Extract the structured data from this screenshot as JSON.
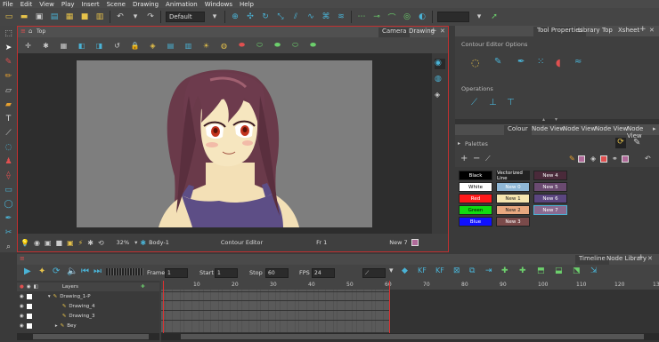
{
  "menu": [
    "File",
    "Edit",
    "View",
    "Play",
    "Insert",
    "Scene",
    "Drawing",
    "Animation",
    "Windows",
    "Help"
  ],
  "toolbar": {
    "workspace": "Default"
  },
  "camera_view": {
    "header": "Top",
    "tabs": [
      "Camera",
      "Drawing"
    ],
    "status": {
      "zoom": "32%",
      "node": "Body-1",
      "mode": "Contour Editor",
      "frame": "Fr 1",
      "colour": "New 7"
    }
  },
  "tool_panel": {
    "tabs": [
      "Tool Properties",
      "Library",
      "Top",
      "Xsheet"
    ],
    "title": "Contour Editor Options",
    "operations": "Operations"
  },
  "colour_panel": {
    "tabs": [
      "Colour",
      "Node View",
      "Node View",
      "Node View",
      "Node View"
    ],
    "palettes_label": "Palettes",
    "swatches": [
      {
        "label": "Black",
        "bg": "#000000",
        "fg": "#ffffff"
      },
      {
        "label": "Vectorized Line",
        "bg": "#222222",
        "fg": "#ffffff"
      },
      {
        "label": "New 4",
        "bg": "#4a2a3a",
        "fg": "#ffffff"
      },
      {
        "label": "White",
        "bg": "#ffffff",
        "fg": "#000000"
      },
      {
        "label": "New 0",
        "bg": "#8fb7d6",
        "fg": "#ffffff"
      },
      {
        "label": "New 5",
        "bg": "#6a4a70",
        "fg": "#ffffff"
      },
      {
        "label": "Red",
        "bg": "#ff1a1a",
        "fg": "#ffffff"
      },
      {
        "label": "New 1",
        "bg": "#f6e6b0",
        "fg": "#222222"
      },
      {
        "label": "New 6",
        "bg": "#5b4680",
        "fg": "#ffffff"
      },
      {
        "label": "Green",
        "bg": "#11dd11",
        "fg": "#000000"
      },
      {
        "label": "New 2",
        "bg": "#e8a880",
        "fg": "#222222"
      },
      {
        "label": "New 7",
        "bg": "#8a6a90",
        "fg": "#ffffff"
      },
      {
        "label": "Blue",
        "bg": "#1010ff",
        "fg": "#ffffff"
      },
      {
        "label": "New 3",
        "bg": "#7a4a4a",
        "fg": "#ffffff"
      }
    ]
  },
  "timeline": {
    "tabs": [
      "Timeline",
      "Node Library"
    ],
    "frame_label": "Frame",
    "frame": "1",
    "start_label": "Start",
    "start": "1",
    "stop_label": "Stop",
    "stop": "60",
    "fps_label": "FPS",
    "fps": "24",
    "layers_label": "Layers",
    "layers": [
      "Drawing_1-P",
      "Drawing_4",
      "Drawing_3",
      "Bey"
    ],
    "ruler": [
      "10",
      "20",
      "30",
      "40",
      "50",
      "60",
      "70",
      "80",
      "90",
      "100",
      "110",
      "120",
      "13"
    ]
  }
}
